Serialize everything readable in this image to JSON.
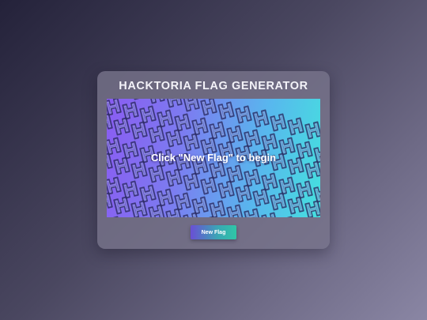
{
  "app": {
    "title": "HACKTORIA FLAG GENERATOR"
  },
  "flag": {
    "prompt": "Click \"New Flag\" to begin",
    "pattern_icon": "h-letter-tile-icon",
    "gradient": [
      "#8a5cf2",
      "#7c7cf0",
      "#58b7ee",
      "#45e0de"
    ]
  },
  "controls": {
    "new_flag_label": "New Flag"
  },
  "colors": {
    "accent_start": "#6a4fd4",
    "accent_end": "#2fc6a6"
  }
}
